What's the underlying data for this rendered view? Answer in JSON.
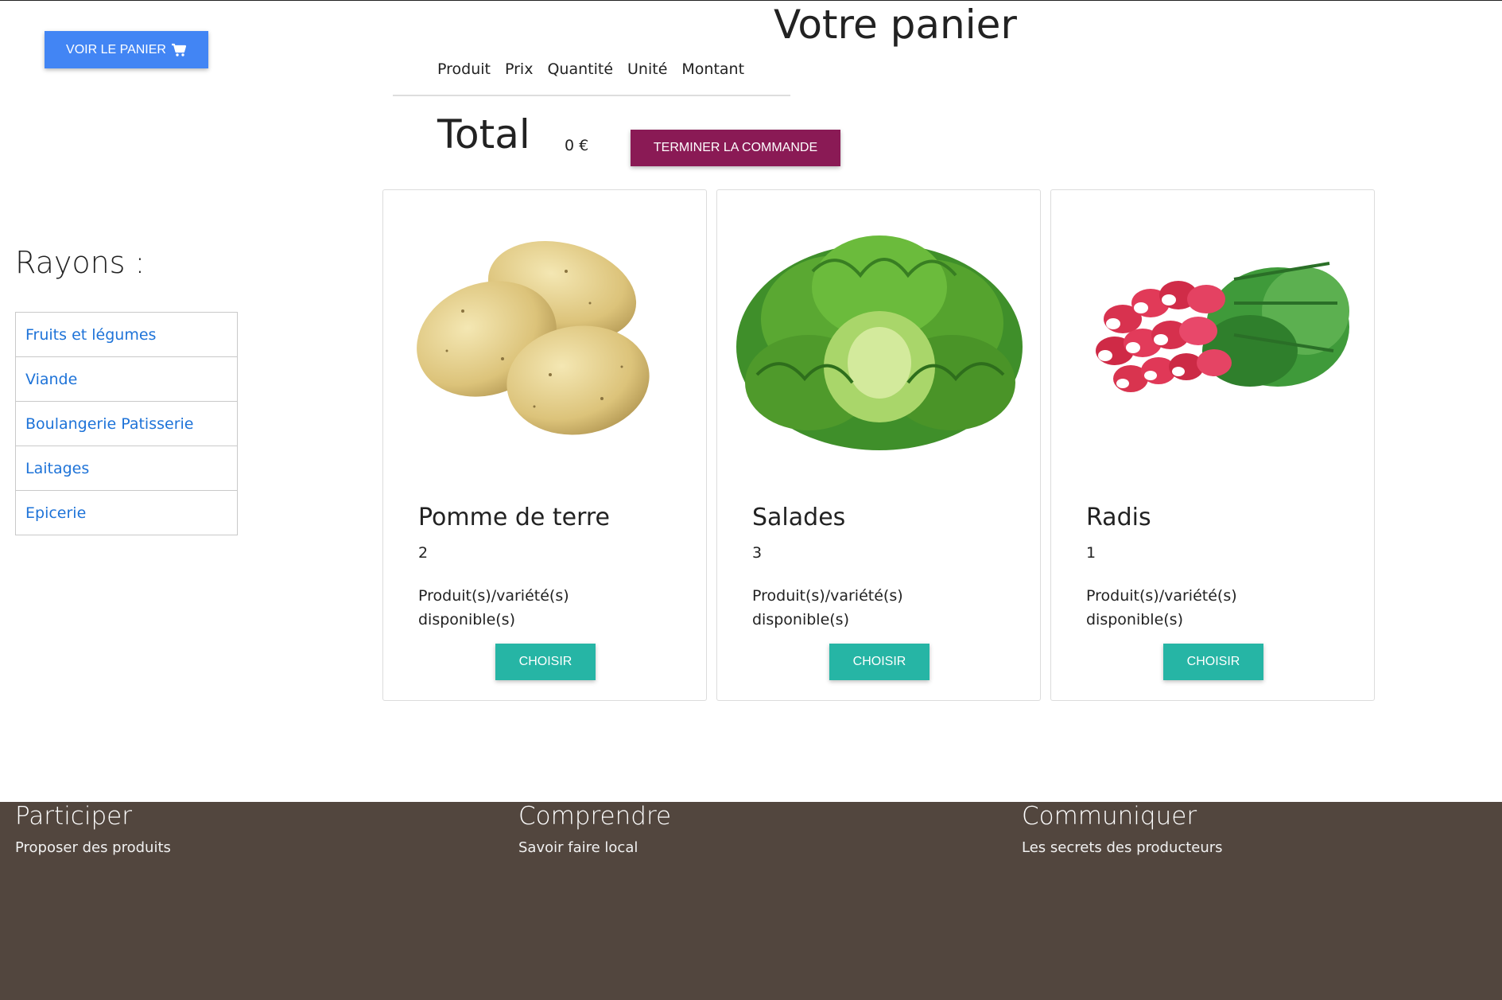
{
  "header": {
    "cart_button_label": "VOIR LE PANIER",
    "cart_icon": "shopping-cart-icon"
  },
  "cart": {
    "title": "Votre panier",
    "columns": [
      "Produit",
      "Prix",
      "Quantité",
      "Unité",
      "Montant"
    ],
    "total_label": "Total",
    "total_value": "0 €",
    "finish_button_label": "TERMINER LA COMMANDE"
  },
  "sidebar": {
    "title": "Rayons :",
    "items": [
      {
        "label": "Fruits et légumes"
      },
      {
        "label": "Viande"
      },
      {
        "label": "Boulangerie Patisserie"
      },
      {
        "label": "Laitages"
      },
      {
        "label": "Epicerie"
      }
    ]
  },
  "products": [
    {
      "name": "Pomme de terre",
      "count": "2",
      "availability": "Produit(s)/variété(s) disponible(s)",
      "button_label": "CHOISIR",
      "image": "potatoes-image"
    },
    {
      "name": "Salades",
      "count": "3",
      "availability": "Produit(s)/variété(s) disponible(s)",
      "button_label": "CHOISIR",
      "image": "lettuce-image"
    },
    {
      "name": "Radis",
      "count": "1",
      "availability": "Produit(s)/variété(s) disponible(s)",
      "button_label": "CHOISIR",
      "image": "radishes-image"
    }
  ],
  "footer": {
    "columns": [
      {
        "title": "Participer",
        "link": "Proposer des produits"
      },
      {
        "title": "Comprendre",
        "link": "Savoir faire local"
      },
      {
        "title": "Communiquer",
        "link": "Les secrets des producteurs"
      }
    ]
  },
  "colors": {
    "cart_button": "#4285f4",
    "finish_button": "#8a1a55",
    "choose_button": "#26b5a5",
    "link": "#1e73d8",
    "footer_bg": "#52463e"
  }
}
